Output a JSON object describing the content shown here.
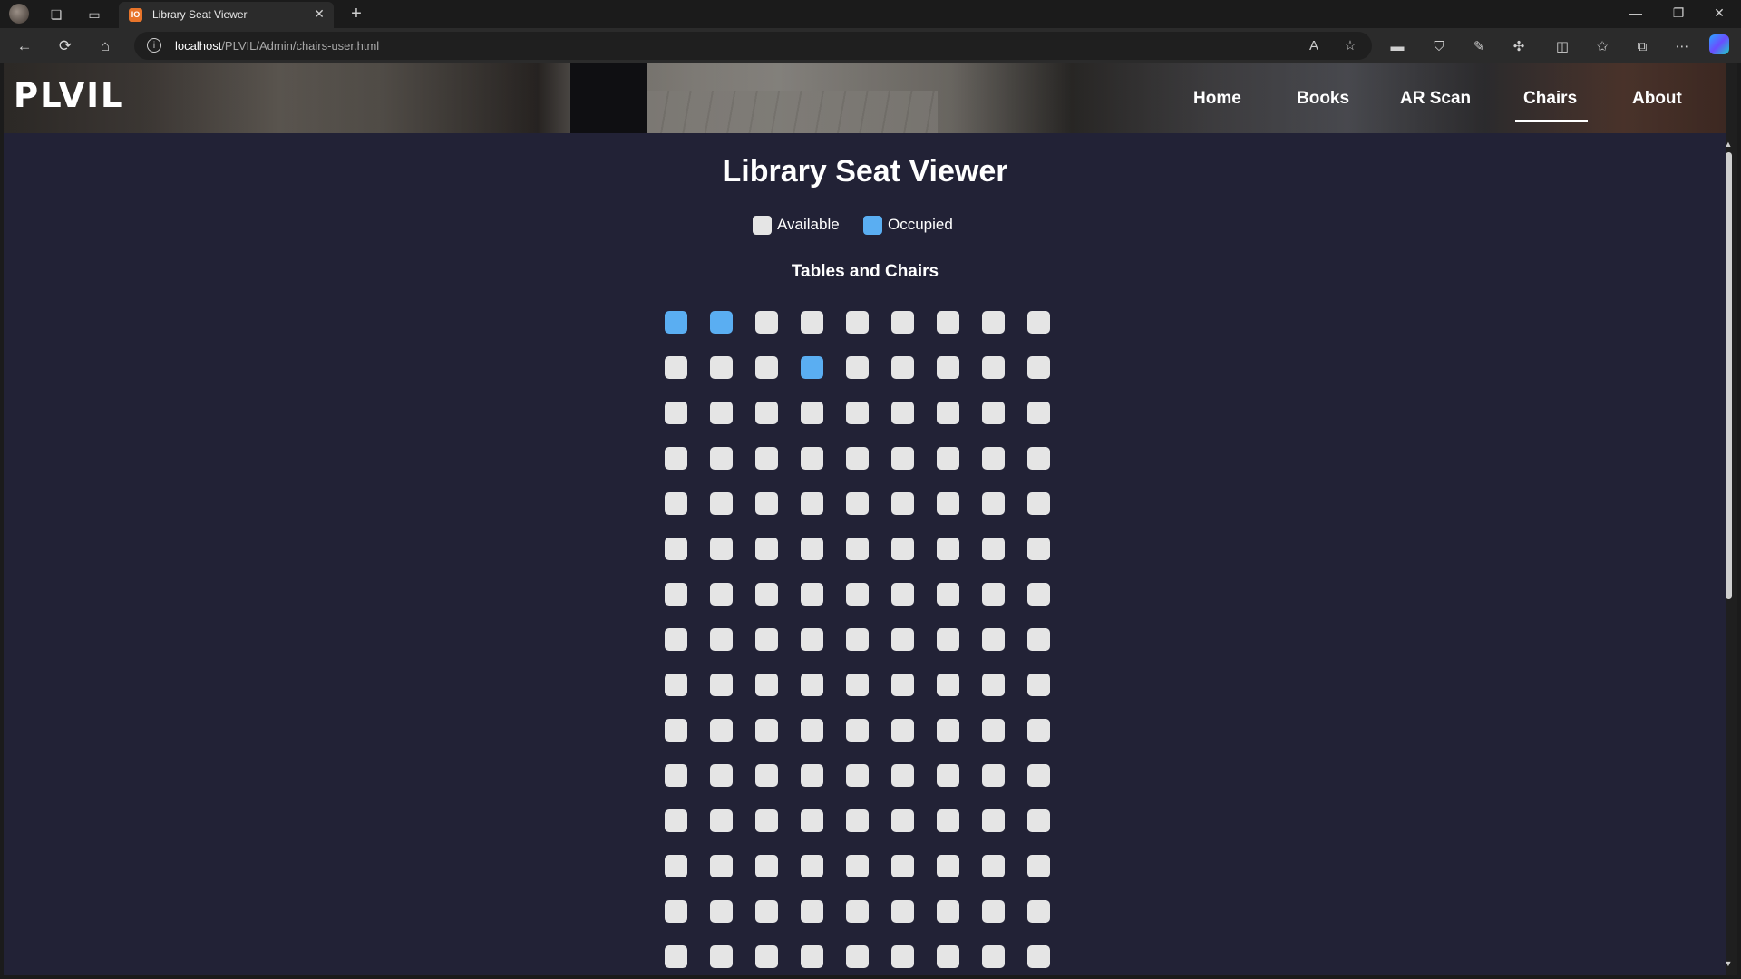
{
  "browser": {
    "tab_title": "Library Seat Viewer",
    "tab_favicon_text": "IO",
    "url_host": "localhost",
    "url_path": "/PLVIL/Admin/chairs-user.html",
    "icons": {
      "back": "←",
      "refresh": "⟳",
      "home": "⌂",
      "new_tab": "+",
      "close_tab": "✕",
      "minimize": "—",
      "restore": "❐",
      "close_window": "✕",
      "read_aloud": "A",
      "favorite": "☆",
      "more": "⋯"
    }
  },
  "site": {
    "logo": "PLVIL",
    "nav": [
      "Home",
      "Books",
      "AR Scan",
      "Chairs",
      "About"
    ],
    "active_nav": "Chairs"
  },
  "main": {
    "title": "Library Seat Viewer",
    "legend": {
      "available": "Available",
      "occupied": "Occupied"
    },
    "section_title": "Tables and Chairs",
    "colors": {
      "available": "#e5e5e5",
      "occupied": "#5aaef2",
      "background": "#222236"
    },
    "seat_grid": {
      "columns": 9,
      "visible_rows": 15,
      "occupied": [
        [
          0,
          0
        ],
        [
          0,
          1
        ],
        [
          1,
          3
        ]
      ]
    }
  }
}
